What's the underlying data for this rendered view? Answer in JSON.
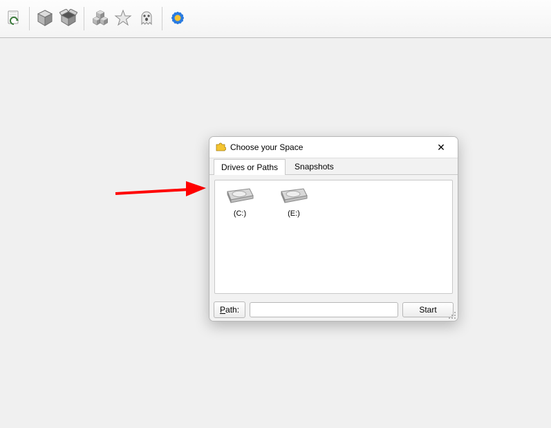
{
  "toolbar": {
    "refresh": "refresh",
    "cube1": "cube",
    "cube2": "cube-open",
    "cubes": "cube-group",
    "star": "favorite",
    "ghost": "ghost",
    "gear": "flower-gear"
  },
  "dialog": {
    "title": "Choose your Space",
    "close": "✕",
    "tabs": {
      "drives": "Drives or Paths",
      "snapshots": "Snapshots"
    },
    "drives": [
      {
        "label": "(C:)"
      },
      {
        "label": "(E:)"
      }
    ],
    "path_label_first": "P",
    "path_label_rest": "ath:",
    "path_value": "",
    "start": "Start"
  }
}
